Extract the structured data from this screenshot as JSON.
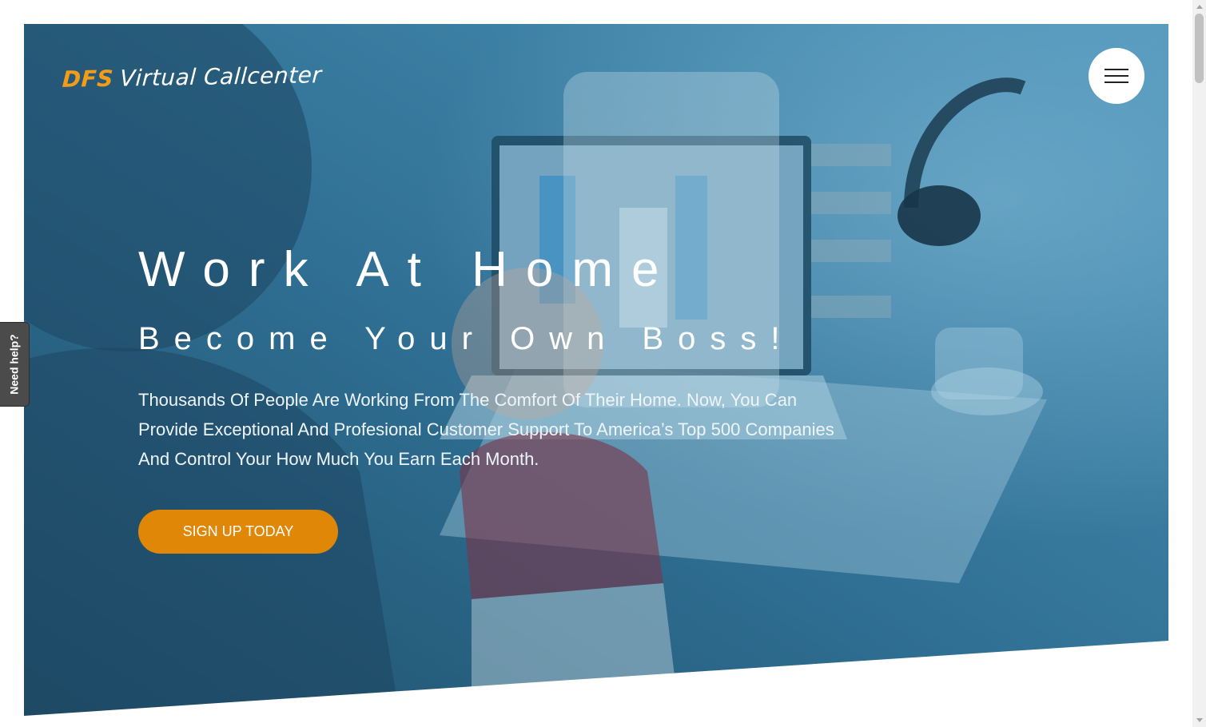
{
  "logo": {
    "brand": "DFS",
    "name": "Virtual Callcenter"
  },
  "menu": {
    "icon": "hamburger-menu-icon"
  },
  "hero": {
    "headline": "Work At Home",
    "subheadline": "Become Your Own Boss!",
    "lead": "Thousands Of People Are Working From The Comfort Of Their Home. Now, You Can Provide Exceptional And Profesional Customer Support To America’s Top 500 Companies And Control Your How Much You Earn Each Month.",
    "cta_label": "SIGN UP TODAY"
  },
  "help_tab": {
    "label": "Need help?"
  },
  "colors": {
    "overlay": "#2d6f93",
    "accent": "#e08707",
    "logo_brand": "#f39c1a"
  }
}
